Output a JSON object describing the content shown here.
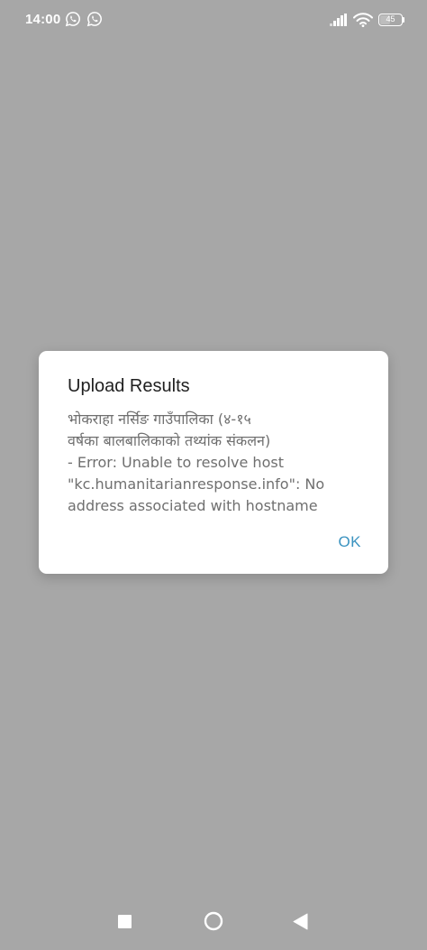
{
  "status_bar": {
    "time": "14:00",
    "battery_level": "45",
    "icons": [
      "whatsapp-icon",
      "whatsapp-icon",
      "signal-icon",
      "wifi-icon",
      "battery-icon"
    ]
  },
  "dialog": {
    "title": "Upload Results",
    "message_lines": [
      "भोकराहा नर्सिङ गाउँपालिका (४-१५",
      "वर्षका बालबालिकाको तथ्यांक संकलन)",
      "- Error: Unable to resolve host",
      "\"kc.humanitarianresponse.info\": No",
      "address associated with hostname"
    ],
    "ok_label": "OK"
  },
  "nav_bar": {
    "icons": [
      "recents-icon",
      "home-icon",
      "back-icon"
    ]
  },
  "colors": {
    "backdrop": "#a7a7a7",
    "dialog_bg": "#ffffff",
    "accent": "#3b93c0"
  }
}
